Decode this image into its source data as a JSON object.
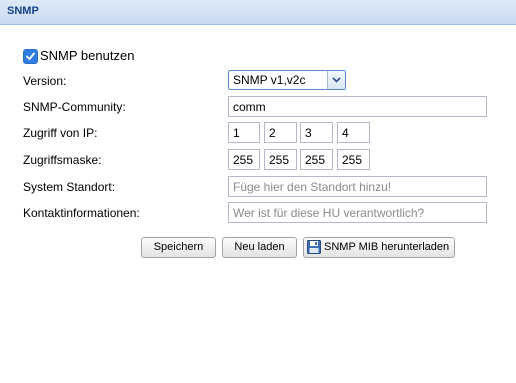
{
  "panel": {
    "title": "SNMP"
  },
  "form": {
    "enable_label": "SNMP benutzen",
    "enabled": true,
    "version": {
      "label": "Version:",
      "value": "SNMP v1,v2c"
    },
    "community": {
      "label": "SNMP-Community:",
      "value": "comm"
    },
    "access_ip": {
      "label": "Zugriff von IP:",
      "octets": [
        "1",
        "2",
        "3",
        "4"
      ]
    },
    "access_mask": {
      "label": "Zugriffsmaske:",
      "octets": [
        "255",
        "255",
        "255",
        "255"
      ]
    },
    "location": {
      "label": "System Standort:",
      "placeholder": "Füge hier den Standort hinzu!"
    },
    "contact": {
      "label": "Kontaktinformationen:",
      "placeholder": "Wer ist für diese HU verantwortlich?"
    }
  },
  "buttons": {
    "save": "Speichern",
    "reload": "Neu laden",
    "download_mib": "SNMP MIB herunterladen"
  },
  "icons": {
    "checkbox": "check-icon",
    "select": "chevron-down-icon",
    "download": "floppy-disk-icon"
  }
}
